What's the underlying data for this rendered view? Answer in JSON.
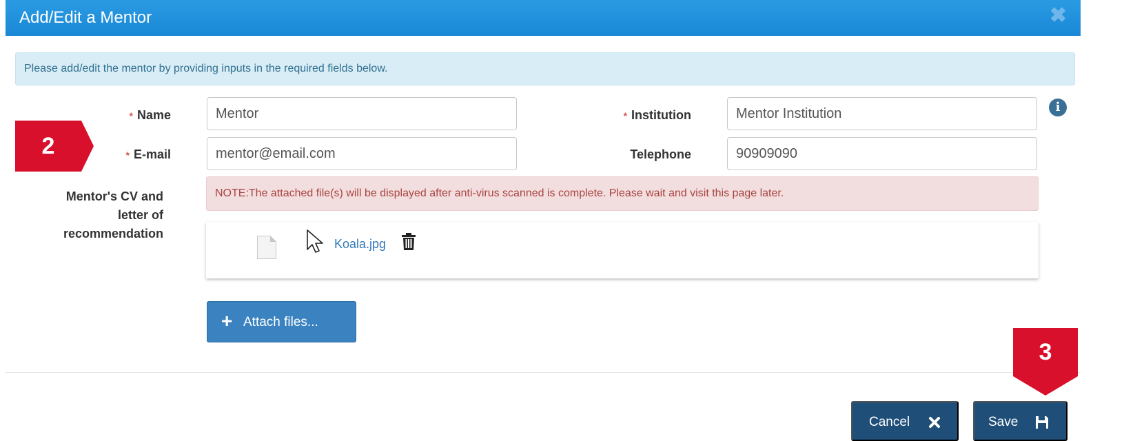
{
  "dialog": {
    "title": "Add/Edit a Mentor",
    "close_glyph": "✖"
  },
  "info_message": "Please add/edit the mentor by providing inputs in the required fields below.",
  "form": {
    "required_marker": "*",
    "name": {
      "label": "Name",
      "value": "Mentor",
      "required": true
    },
    "email": {
      "label": "E-mail",
      "value": "mentor@email.com",
      "required": true
    },
    "institution": {
      "label": "Institution",
      "value": "Mentor Institution",
      "required": true
    },
    "telephone": {
      "label": "Telephone",
      "value": "90909090",
      "required": false
    },
    "cv_label_line1": "Mentor's CV and",
    "cv_label_line2": "letter of",
    "cv_label_line3": "recommendation"
  },
  "warning_message": "NOTE:The attached file(s) will be displayed after anti-virus scanned is complete. Please wait and visit this page later.",
  "attachments": [
    {
      "filename": "Koala.jpg",
      "icon": "file-icon"
    }
  ],
  "buttons": {
    "attach_label": "Attach files...",
    "cancel_label": "Cancel",
    "save_label": "Save"
  },
  "annotations": {
    "step2": "2",
    "step3": "3"
  },
  "colors": {
    "titlebar": "#1a88d6",
    "button_primary": "#1f4e79",
    "attach_button": "#3b83c0",
    "marker": "#d8102c",
    "link": "#337ab7"
  }
}
